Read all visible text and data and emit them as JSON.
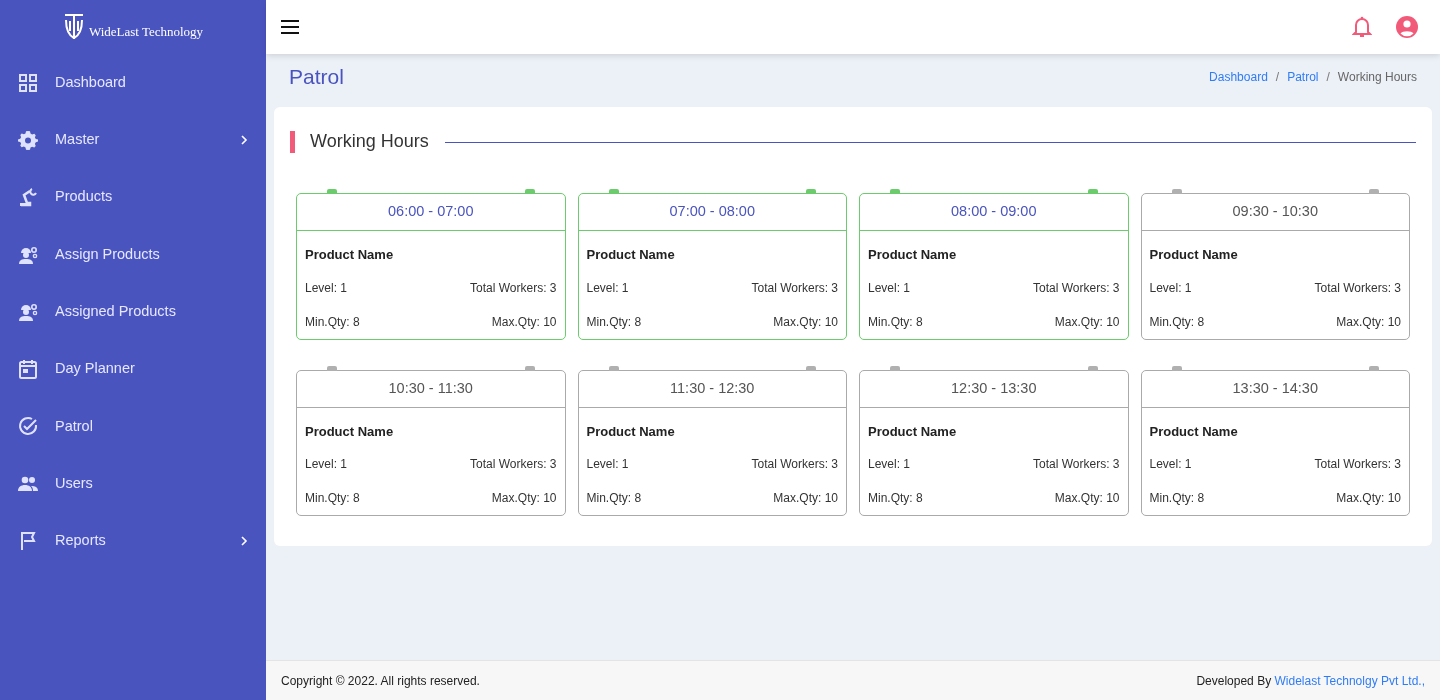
{
  "sidebar": {
    "logo_text": "WideLast Technology",
    "items": [
      {
        "label": "Dashboard",
        "has_submenu": false
      },
      {
        "label": "Master",
        "has_submenu": true
      },
      {
        "label": "Products",
        "has_submenu": false
      },
      {
        "label": "Assign Products",
        "has_submenu": false
      },
      {
        "label": "Assigned Products",
        "has_submenu": false
      },
      {
        "label": "Day Planner",
        "has_submenu": false
      },
      {
        "label": "Patrol",
        "has_submenu": false
      },
      {
        "label": "Users",
        "has_submenu": false
      },
      {
        "label": "Reports",
        "has_submenu": true
      }
    ]
  },
  "page": {
    "title": "Patrol",
    "breadcrumb": [
      {
        "label": "Dashboard",
        "link": true
      },
      {
        "separator": "/",
        "label": "Patrol",
        "link": true
      },
      {
        "separator": "/",
        "label": "Working Hours",
        "link": false
      }
    ]
  },
  "section": {
    "title": "Working Hours",
    "slots": [
      {
        "time": "06:00 - 07:00",
        "active": true,
        "product": "Product Name",
        "level": "Level: 1",
        "workers": "Total Workers: 3",
        "min": "Min.Qty: 8",
        "max": "Max.Qty: 10"
      },
      {
        "time": "07:00 - 08:00",
        "active": true,
        "product": "Product Name",
        "level": "Level: 1",
        "workers": "Total Workers: 3",
        "min": "Min.Qty: 8",
        "max": "Max.Qty: 10"
      },
      {
        "time": "08:00 - 09:00",
        "active": true,
        "product": "Product Name",
        "level": "Level: 1",
        "workers": "Total Workers: 3",
        "min": "Min.Qty: 8",
        "max": "Max.Qty: 10"
      },
      {
        "time": "09:30 - 10:30",
        "active": false,
        "product": "Product Name",
        "level": "Level: 1",
        "workers": "Total Workers: 3",
        "min": "Min.Qty: 8",
        "max": "Max.Qty: 10"
      },
      {
        "time": "10:30 - 11:30",
        "active": false,
        "product": "Product Name",
        "level": "Level: 1",
        "workers": "Total Workers: 3",
        "min": "Min.Qty: 8",
        "max": "Max.Qty: 10"
      },
      {
        "time": "11:30 - 12:30",
        "active": false,
        "product": "Product Name",
        "level": "Level: 1",
        "workers": "Total Workers: 3",
        "min": "Min.Qty: 8",
        "max": "Max.Qty: 10"
      },
      {
        "time": "12:30 - 13:30",
        "active": false,
        "product": "Product Name",
        "level": "Level: 1",
        "workers": "Total Workers: 3",
        "min": "Min.Qty: 8",
        "max": "Max.Qty: 10"
      },
      {
        "time": "13:30 - 14:30",
        "active": false,
        "product": "Product Name",
        "level": "Level: 1",
        "workers": "Total Workers: 3",
        "min": "Min.Qty: 8",
        "max": "Max.Qty: 10"
      }
    ]
  },
  "footer": {
    "copyright": "Copyright © 2022. All rights reserved.",
    "developed_by": "Developed By",
    "developer_link": "Widelast Technolgy Pvt Ltd.,"
  }
}
